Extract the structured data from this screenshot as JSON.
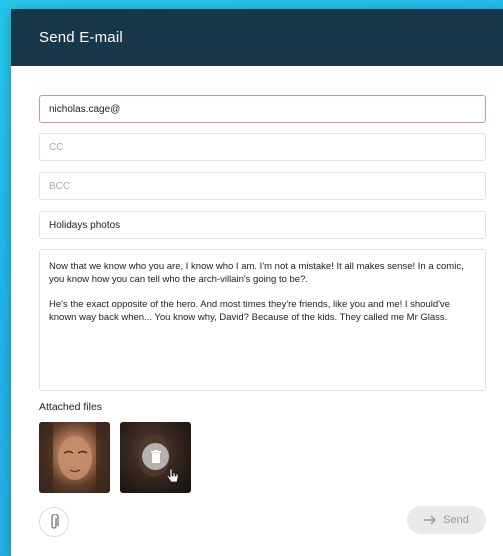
{
  "dialog": {
    "title": "Send E-mail"
  },
  "form": {
    "to_value": "nicholas.cage@",
    "cc_placeholder": "CC",
    "bcc_placeholder": "BCC",
    "subject_value": "Holidays photos",
    "body_paragraphs": [
      "Now that we know who you are, I know who I am. I'm not a mistake! It all makes sense! In a comic, you know how you can tell who the arch-villain's going to be?.",
      "He's the exact opposite of the hero. And most times they're friends, like you and me! I should've known way back when... You know why, David? Because of the kids. They called me Mr Glass."
    ]
  },
  "attachments": {
    "title": "Attached files",
    "items": [
      {
        "name": "photo-1",
        "icon": "image-thumbnail"
      },
      {
        "name": "photo-2",
        "icon": "image-thumbnail",
        "hover_action_icon": "trash-icon"
      }
    ]
  },
  "footer": {
    "attach_icon": "paperclip-icon",
    "send_label": "Send",
    "send_icon": "arrow-right-icon"
  },
  "colors": {
    "header_bg": "#17384a",
    "page_bg": "#1fb4e6",
    "error_border": "#e08f93",
    "disabled_button_bg": "#e9e9e9"
  }
}
